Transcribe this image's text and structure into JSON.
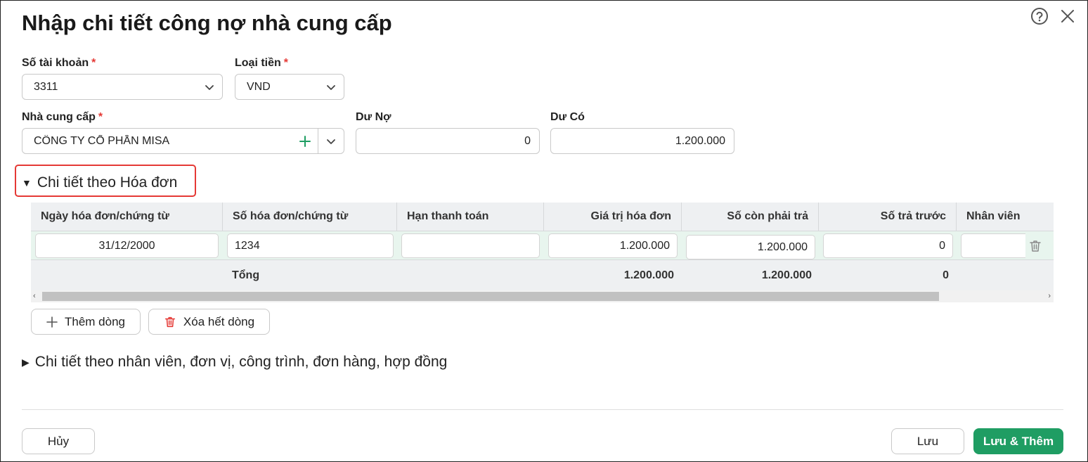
{
  "dialog": {
    "title": "Nhập chi tiết công nợ nhà cung cấp"
  },
  "icons": {
    "help": "help-circle-icon",
    "close": "close-icon",
    "chevron": "chevron-down-icon",
    "plus": "plus-icon",
    "trash": "trash-icon"
  },
  "form": {
    "account": {
      "label": "Số tài khoản",
      "required": "*",
      "value": "3311"
    },
    "currency": {
      "label": "Loại tiền",
      "required": "*",
      "value": "VND"
    },
    "supplier": {
      "label": "Nhà cung cấp",
      "required": "*",
      "value": "CÔNG TY CỔ PHẦN MISA"
    },
    "debit": {
      "label": "Dư Nợ",
      "value": "0"
    },
    "credit": {
      "label": "Dư Có",
      "value": "1.200.000"
    }
  },
  "section_invoice": {
    "label": "Chi tiết theo Hóa đơn",
    "columns": [
      "Ngày hóa đơn/chứng từ",
      "Số hóa đơn/chứng từ",
      "Hạn thanh toán",
      "Giá trị hóa đơn",
      "Số còn phải trả",
      "Số trả trước",
      "Nhân viên"
    ],
    "rows": [
      {
        "date": "31/12/2000",
        "number": "1234",
        "due": "",
        "value": "1.200.000",
        "remaining": "1.200.000",
        "prepaid": "0",
        "employee": ""
      }
    ],
    "total": {
      "label": "Tổng",
      "value": "1.200.000",
      "remaining": "1.200.000",
      "prepaid": "0"
    },
    "add_row_label": "Thêm dòng",
    "delete_all_label": "Xóa hết dòng"
  },
  "section_employee": {
    "label": "Chi tiết theo nhân viên, đơn vị, công trình, đơn hàng, hợp đồng"
  },
  "footer": {
    "cancel_label": "Hủy",
    "save_label": "Lưu",
    "save_add_label": "Lưu & Thêm"
  },
  "colors": {
    "primary": "#1f9d63",
    "required": "#e53935",
    "highlight": "#e53935",
    "row_selected": "#e8f5ee"
  }
}
